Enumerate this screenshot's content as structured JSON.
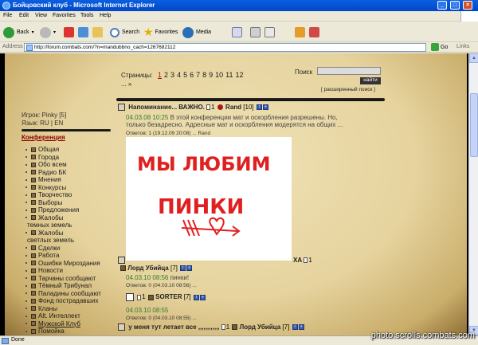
{
  "window": {
    "title": "Бойцовский клуб - Microsoft Internet Explorer",
    "min": "_",
    "max": "□",
    "close": "×"
  },
  "menu": [
    "File",
    "Edit",
    "View",
    "Favorites",
    "Tools",
    "Help"
  ],
  "toolbar": {
    "back": "Back",
    "search": "Search",
    "favorites": "Favorites",
    "media": "Media"
  },
  "address": {
    "label": "Address",
    "url": "http://forum.combats.com/?n=mandubbno_cach=1267682112",
    "go": "Go",
    "links": "Links"
  },
  "status": {
    "text": "Done"
  },
  "watermark": "photo.scrolls.combats.com",
  "forum": {
    "pages_label": "Страницы:",
    "pages": [
      "1",
      "2",
      "3",
      "4",
      "5",
      "6",
      "7",
      "8",
      "9",
      "10",
      "11",
      "12"
    ],
    "current_page": "1",
    "pages_more": "... »",
    "search_label": "Поиск",
    "search_value": "",
    "search_button": "найти",
    "advanced_search": "[ расширенный поиск ]",
    "player": "Игрок: Pinky [5]",
    "lang": "Язык: RU | EN",
    "conference_title": "Конференция",
    "nav": [
      "Общая",
      "Города",
      "Обо всем",
      "Радио БК",
      "Мнения",
      "Конкурсы",
      "Творчество",
      "Выборы",
      "Предложения",
      "Жалобы",
      "темных земель",
      "Жалобы",
      "светлых земель",
      "Сделки",
      "Работа",
      "Ошибки Мироздания",
      "Новости",
      "Тарчаны сообщают",
      "Тёмный Трибунал",
      "Паладины сообщают",
      "Фонд пострадавших",
      "Кланы",
      "Alt. Интеллект",
      "Мужской Клуб",
      "Помойка"
    ],
    "posts": [
      {
        "title": "Напоминание... ВАЖНО.",
        "count": "1",
        "user": "Rand",
        "level": "[10]",
        "meta": "04.03.08 10:25",
        "excerpt": "В этой конференции мат и оскорбления разрешены. Но,",
        "excerpt2": "только безадресно. Адресные мат и оскорбления модерятся на общих ...",
        "replies": "Ответов: 1  (19.12.09 20:08) ... Rand"
      },
      {
        "title_tail": "ХА",
        "count": "1",
        "user": "Лорд Убийца",
        "level": "[7]",
        "meta": "04.03.10 08:56",
        "excerpt": "пинки!",
        "replies": "Ответов: 0  (04.03.10 08:56) ..."
      },
      {
        "count": "1",
        "user": "SORTER",
        "level": "[7]",
        "meta": "04.03.10 08:55",
        "replies": "Ответов: 0  (04.03.10 08:55) ..."
      },
      {
        "title": "у меня тут летает все ,,,,,,,,,,,,",
        "count": "1",
        "user": "Лорд Убийца",
        "level": "[7]"
      }
    ],
    "drawing_text_line1": "МЫ ЛЮБИМ",
    "drawing_text_line2": "ПИНКИ"
  },
  "colors": {
    "titlebar": "#0a5fe0",
    "parchment": "#e6d39e",
    "conference": "#8b0000",
    "meta_green": "#2e7d32",
    "drawing_red": "#e02020"
  }
}
